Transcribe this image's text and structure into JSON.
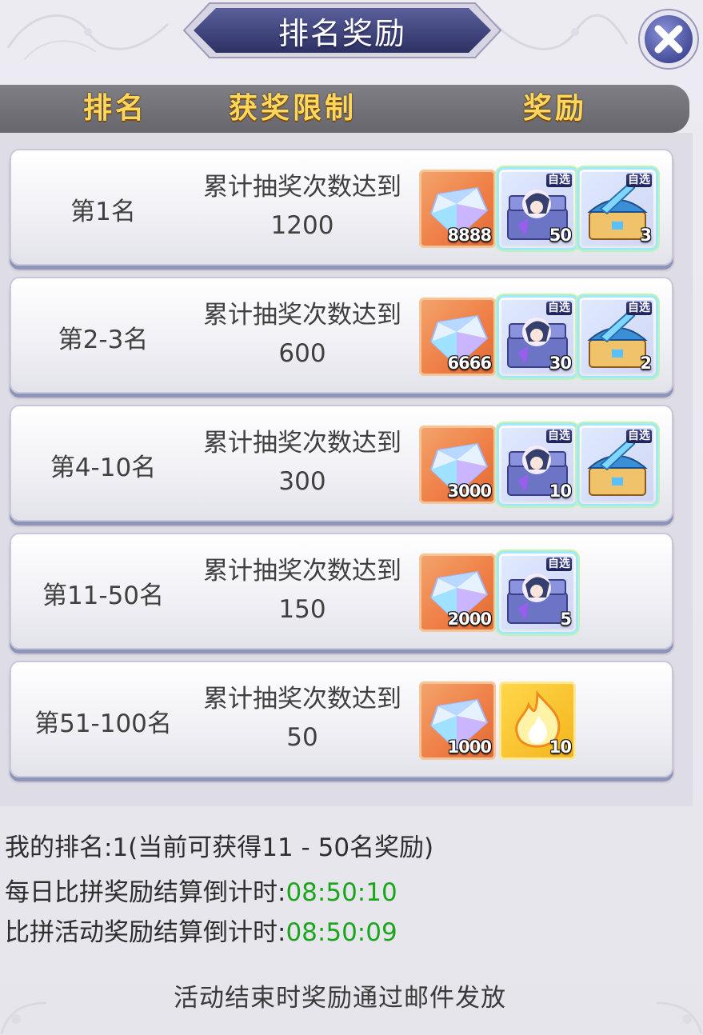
{
  "title": "排名奖励",
  "header": {
    "rank": "排名",
    "limit": "获奖限制",
    "reward": "奖励"
  },
  "rows": [
    {
      "rank": "第1名",
      "limit_line1": "累计抽奖次数达到",
      "limit_line2": "1200",
      "rewards": [
        {
          "icon": "diamond-icon",
          "qty": "8888"
        },
        {
          "icon": "character-chest-icon",
          "tag": "自选",
          "qty": "50"
        },
        {
          "icon": "equipment-chest-icon",
          "tag": "自选",
          "qty": "3"
        }
      ]
    },
    {
      "rank": "第2-3名",
      "limit_line1": "累计抽奖次数达到",
      "limit_line2": "600",
      "rewards": [
        {
          "icon": "diamond-icon",
          "qty": "6666"
        },
        {
          "icon": "character-chest-icon",
          "tag": "自选",
          "qty": "30"
        },
        {
          "icon": "equipment-chest-icon",
          "tag": "自选",
          "qty": "2"
        }
      ]
    },
    {
      "rank": "第4-10名",
      "limit_line1": "累计抽奖次数达到",
      "limit_line2": "300",
      "rewards": [
        {
          "icon": "diamond-icon",
          "qty": "3000"
        },
        {
          "icon": "character-chest-icon",
          "tag": "自选",
          "qty": "10"
        },
        {
          "icon": "equipment-chest-icon",
          "tag": "自选",
          "qty": ""
        }
      ]
    },
    {
      "rank": "第11-50名",
      "limit_line1": "累计抽奖次数达到",
      "limit_line2": "150",
      "rewards": [
        {
          "icon": "diamond-icon",
          "qty": "2000"
        },
        {
          "icon": "character-chest-icon",
          "tag": "自选",
          "qty": "5"
        }
      ]
    },
    {
      "rank": "第51-100名",
      "limit_line1": "累计抽奖次数达到",
      "limit_line2": "50",
      "rewards": [
        {
          "icon": "diamond-icon",
          "qty": "1000"
        },
        {
          "icon": "flame-icon",
          "qty": "10"
        }
      ]
    }
  ],
  "footer": {
    "my_rank": "我的排名:1(当前可获得11 - 50名奖励)",
    "daily_label": "每日比拼奖励结算倒计时:",
    "daily_time": "08:50:10",
    "event_label": "比拼活动奖励结算倒计时:",
    "event_time": "08:50:09",
    "notice": "活动结束时奖励通过邮件发放"
  },
  "colors": {
    "header_text": "#ffd75a",
    "countdown": "#1aa61a",
    "title_plate": "#3a3f78"
  }
}
